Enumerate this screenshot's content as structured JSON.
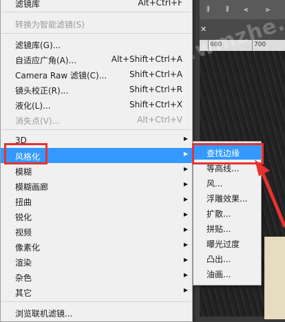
{
  "watermark": "www.wmzhe.com",
  "ruler": {
    "labels": [
      "600",
      "700"
    ]
  },
  "menu": {
    "header_items": [
      {
        "label": "滤镜库",
        "shortcut": "Alt+Ctrl+F",
        "disabled": false
      }
    ],
    "convert_item": {
      "label": "转换为智能滤镜(S)",
      "disabled": true
    },
    "group1": [
      {
        "label": "滤镜库(G)...",
        "shortcut": "",
        "disabled": false
      },
      {
        "label": "自适应广角(A)...",
        "shortcut": "Alt+Shift+Ctrl+A",
        "disabled": false
      },
      {
        "label": "Camera Raw 滤镜(C)...",
        "shortcut": "Shift+Ctrl+A",
        "disabled": false
      },
      {
        "label": "镜头校正(R)...",
        "shortcut": "Shift+Ctrl+R",
        "disabled": false
      },
      {
        "label": "液化(L)...",
        "shortcut": "Shift+Ctrl+X",
        "disabled": false
      },
      {
        "label": "消失点(V)...",
        "shortcut": "Alt+Ctrl+V",
        "disabled": true
      }
    ],
    "group2": [
      {
        "label": "3D"
      },
      {
        "label": "风格化"
      },
      {
        "label": "模糊"
      },
      {
        "label": "模糊画廊"
      },
      {
        "label": "扭曲"
      },
      {
        "label": "锐化"
      },
      {
        "label": "视频"
      },
      {
        "label": "像素化"
      },
      {
        "label": "渲染"
      },
      {
        "label": "杂色"
      },
      {
        "label": "其它"
      }
    ],
    "footer_item": {
      "label": "浏览联机滤镜..."
    }
  },
  "submenu": {
    "items": [
      {
        "label": "查找边缘"
      },
      {
        "label": "等高线..."
      },
      {
        "label": "风..."
      },
      {
        "label": "浮雕效果..."
      },
      {
        "label": "扩散..."
      },
      {
        "label": "拼贴..."
      },
      {
        "label": "曝光过度"
      },
      {
        "label": "凸出..."
      },
      {
        "label": "油画..."
      }
    ]
  },
  "colors": {
    "highlight": "#3399ff",
    "annotation_red": "#e8322f"
  }
}
